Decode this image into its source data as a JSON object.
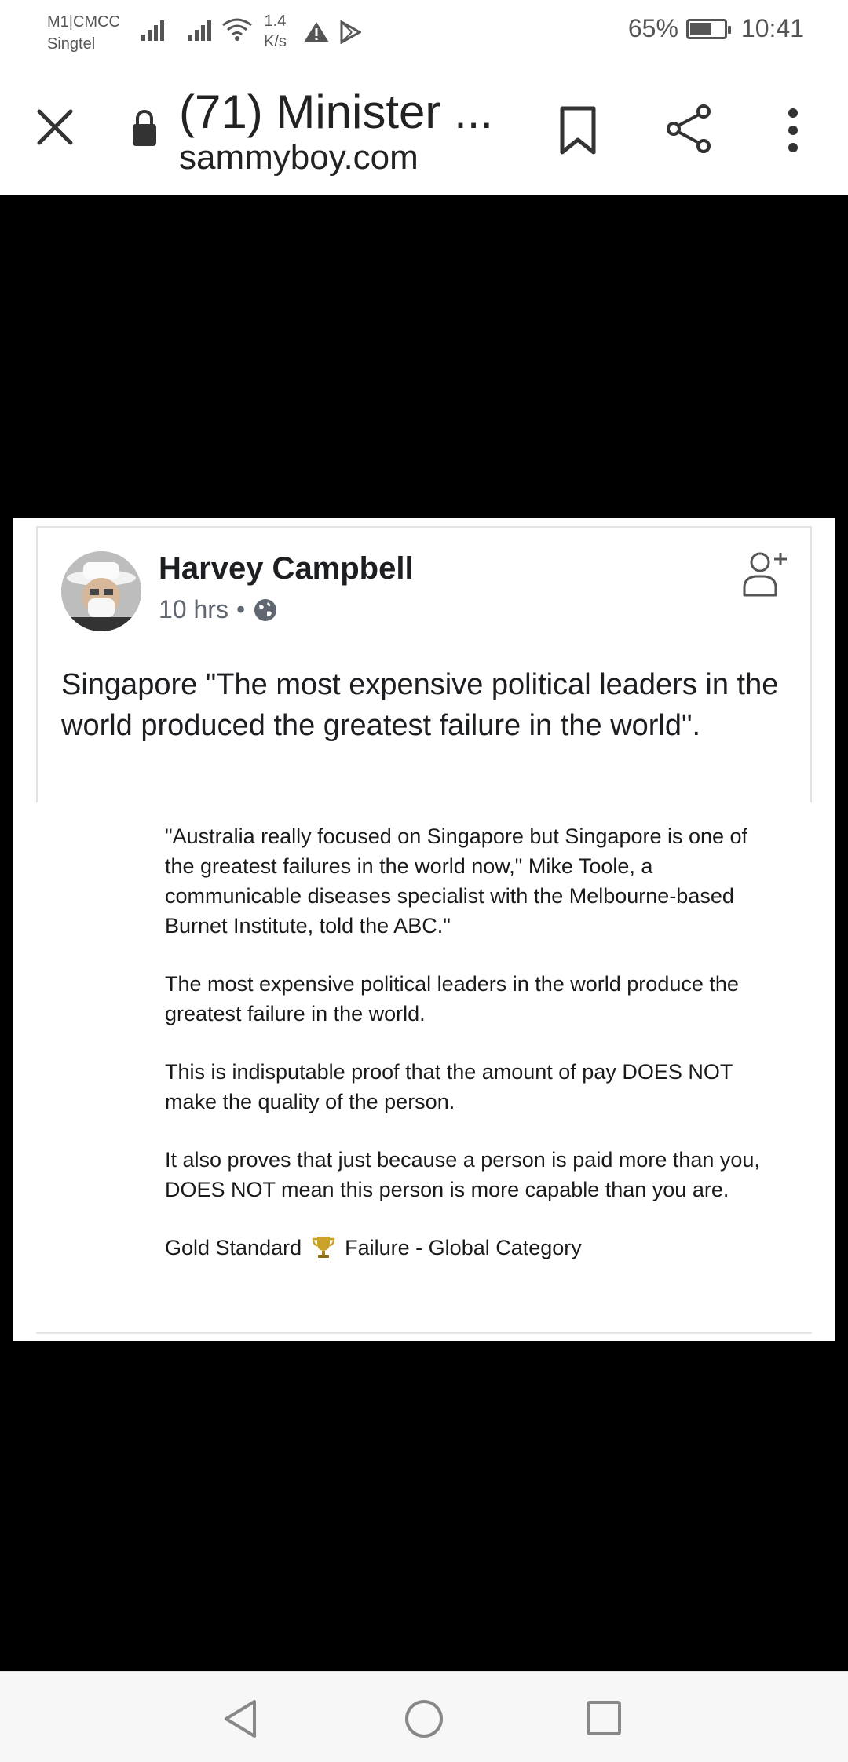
{
  "status_bar": {
    "carrier_line1": "M1|CMCC",
    "carrier_line2": "Singtel",
    "speed_value": "1.4",
    "speed_unit": "K/s",
    "battery_percent": "65%",
    "battery_level": 0.65,
    "time": "10:41",
    "icons": [
      "signal-icon",
      "signal-icon",
      "wifi-icon",
      "warning-icon",
      "play-store-icon",
      "battery-icon"
    ]
  },
  "toolbar": {
    "title": "(71) Minister ...",
    "url": "sammyboy.com",
    "icons": [
      "close-icon",
      "lock-icon",
      "bookmark-icon",
      "share-icon",
      "more-vert-icon"
    ]
  },
  "post": {
    "author": "Harvey Campbell",
    "time": "10 hrs",
    "separator": "•",
    "text": "Singapore \"The most expensive political leaders in the world produced the greatest failure in the world\".",
    "icons": [
      "globe-icon",
      "add-friend-icon",
      "trophy-icon"
    ],
    "quote_paragraphs": [
      "\"Australia really focused on Singapore but Singapore is one of the greatest failures in the world now,\" Mike Toole, a communicable diseases specialist with the Melbourne-based Burnet Institute, told the ABC.\"",
      "The most expensive political leaders in the world produce the greatest failure in the world.",
      "This is indisputable proof that the amount of pay DOES NOT make the quality of the person.",
      "It also proves that just because a person is paid more than you, DOES NOT mean this person is more capable than you are."
    ],
    "gold_prefix": "Gold Standard",
    "gold_suffix": "Failure - Global Category"
  },
  "nav_bar": {
    "icons": [
      "back-icon",
      "home-icon",
      "recents-icon"
    ]
  },
  "colors": {
    "background": "#000000",
    "text": "#1c1e21",
    "meta": "#606770",
    "trophy": "#b8860b"
  }
}
